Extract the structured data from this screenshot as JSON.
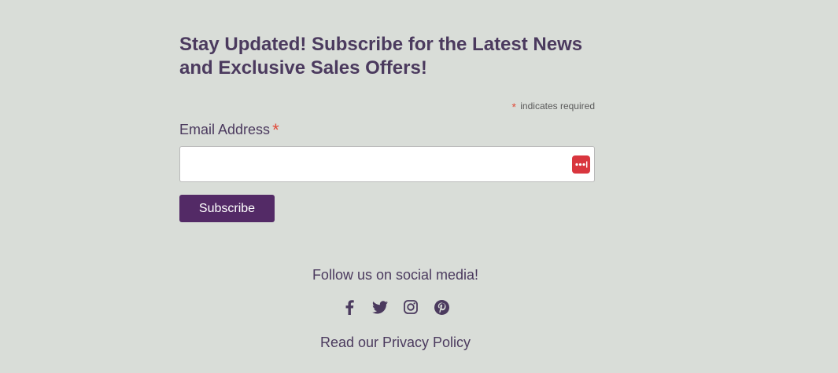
{
  "newsletter": {
    "heading": "Stay Updated! Subscribe for the Latest News and Exclusive Sales Offers!",
    "required_star": "*",
    "required_note": "indicates required",
    "email_label": "Email Address",
    "email_value": "",
    "email_placeholder": "",
    "subscribe_label": "Subscribe"
  },
  "social": {
    "heading": "Follow us on social media!",
    "icons": [
      "facebook-icon",
      "twitter-icon",
      "instagram-icon",
      "pinterest-icon"
    ],
    "privacy_link": "Read our Privacy Policy"
  },
  "colors": {
    "background": "#d9ddd8",
    "text": "#4b3a5e",
    "accent_button": "#532a66",
    "required_star": "#e04b3a",
    "password_manager_icon": "#d9363e"
  }
}
